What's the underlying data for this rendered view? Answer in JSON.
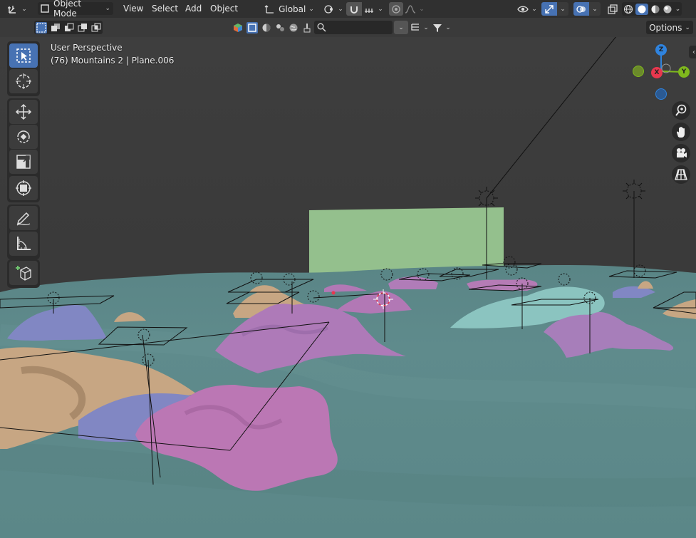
{
  "header": {
    "editor_type_icon": "axes-editor-icon",
    "mode_label": "Object Mode",
    "menus": [
      "View",
      "Select",
      "Add",
      "Object"
    ],
    "transform_orientation": "Global",
    "options_label": "Options"
  },
  "overlay": {
    "view_name": "User Perspective",
    "object_info": "(76) Mountains 2 | Plane.006"
  },
  "gizmo": {
    "z": "Z",
    "x": "X",
    "y": "Y"
  },
  "toolbar": {
    "tools": [
      "select-box",
      "cursor",
      "move",
      "rotate",
      "scale",
      "transform",
      "annotate",
      "measure",
      "add-cube"
    ]
  },
  "colors": {
    "header_bg": "#303030",
    "accent": "#4772b3",
    "ground": "#5f8e8f",
    "mountain_pink": "#b278b5",
    "mountain_blue": "#8187c3",
    "mountain_tan": "#c7a683",
    "mountain_cyan": "#8bc4c0",
    "billboard_green": "#94c08d",
    "axis_x": "#e8374e",
    "axis_y": "#7fb81d",
    "axis_z": "#2f83de"
  }
}
